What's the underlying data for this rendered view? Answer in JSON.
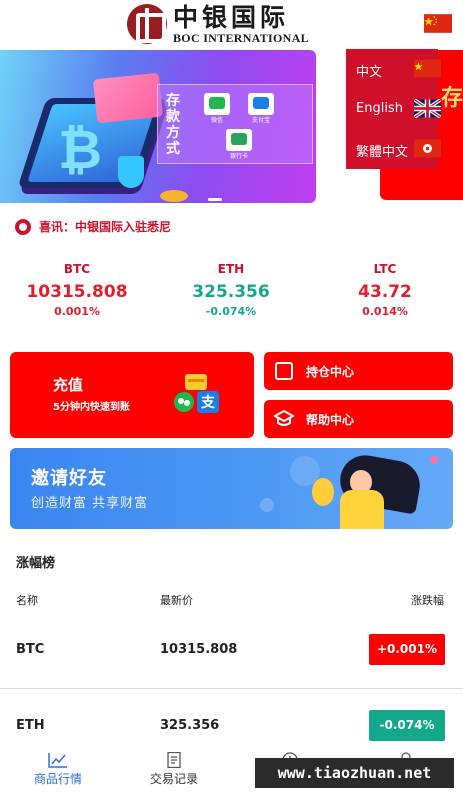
{
  "header": {
    "logo_cn": "中银国际",
    "logo_en": "BOC INTERNATIONAL",
    "current_language_flag": "china-flag-icon"
  },
  "banner": {
    "pay_title": "存款方式",
    "pay_methods": [
      {
        "icon": "wechat-pay-icon",
        "label": "微信",
        "color": "#21b74f"
      },
      {
        "icon": "alipay-icon",
        "label": "支付宝",
        "color": "#1a7ee8"
      },
      {
        "icon": "bank-card-icon",
        "label": "银行卡",
        "color": "#2aa35a"
      }
    ],
    "side_banner_text": "存"
  },
  "language_menu": {
    "items": [
      {
        "label": "中文",
        "flag": "china-flag-icon"
      },
      {
        "label": "English",
        "flag": "uk-flag-icon"
      },
      {
        "label": "繁體中文",
        "flag": "hong-kong-flag-icon"
      }
    ]
  },
  "notice": {
    "text": "喜讯：中银国际入驻悉尼"
  },
  "tickers": [
    {
      "symbol": "BTC",
      "price": "10315.808",
      "change": "0.001%",
      "direction": "up"
    },
    {
      "symbol": "ETH",
      "price": "325.356",
      "change": "-0.074%",
      "direction": "down"
    },
    {
      "symbol": "LTC",
      "price": "43.72",
      "change": "0.014%",
      "direction": "up"
    }
  ],
  "actions": {
    "deposit_title": "充值",
    "deposit_subtitle": "5分钟内快速到账",
    "positions_label": "持仓中心",
    "help_label": "帮助中心"
  },
  "invite": {
    "title": "邀请好友",
    "subtitle": "创造财富 共享财富"
  },
  "board": {
    "title": "涨幅榜",
    "columns": [
      "名称",
      "最新价",
      "涨跌幅"
    ],
    "rows": [
      {
        "symbol": "BTC",
        "price": "10315.808",
        "change": "+0.001%",
        "direction": "up"
      },
      {
        "symbol": "ETH",
        "price": "325.356",
        "change": "-0.074%",
        "direction": "down"
      }
    ]
  },
  "tabbar": {
    "tabs": [
      {
        "label": "商品行情",
        "icon": "chart-icon",
        "active": true
      },
      {
        "label": "交易记录",
        "icon": "document-icon",
        "active": false
      },
      {
        "label": "",
        "icon": "clock-icon",
        "active": false
      },
      {
        "label": "",
        "icon": "user-icon",
        "active": false
      }
    ]
  },
  "watermark": "www.tiaozhuan.net",
  "colors": {
    "brand_red": "#ff0000",
    "menu_red": "#d0102a",
    "up": "#e61e2b",
    "down": "#13a88a",
    "active_tab": "#2a6fd6"
  }
}
